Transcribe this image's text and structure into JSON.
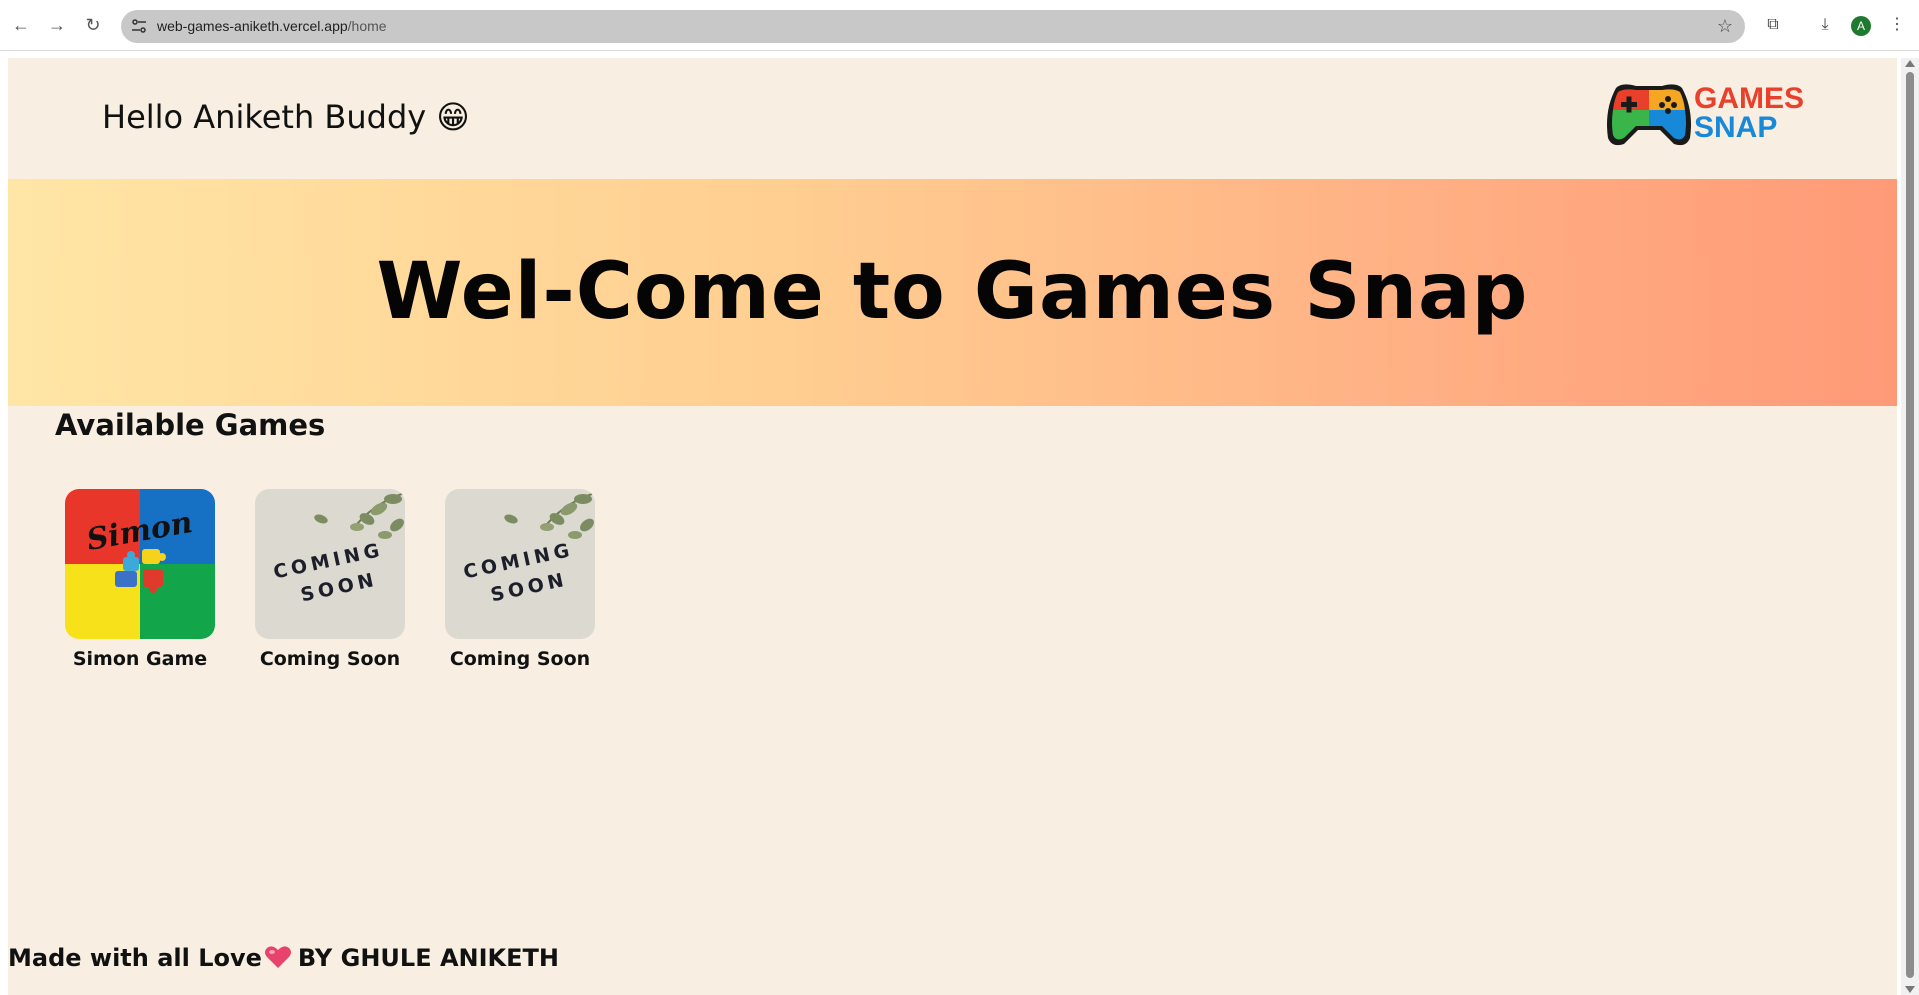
{
  "browser": {
    "url_host": "web-games-aniketh.vercel.app",
    "url_path": "/home",
    "profile_initial": "A"
  },
  "header": {
    "greeting": "Hello Aniketh Buddy 😁",
    "logo_line1": "GAMES",
    "logo_line2": "SNAP"
  },
  "banner": {
    "title": "Wel-Come to Games Snap"
  },
  "games_section": {
    "title": "Available Games",
    "games": [
      {
        "label": "Simon Game",
        "thumbnail_text": "Simon"
      },
      {
        "label": "Coming Soon",
        "thumbnail_line1": "COMING",
        "thumbnail_line2": "SOON"
      },
      {
        "label": "Coming Soon",
        "thumbnail_line1": "COMING",
        "thumbnail_line2": "SOON"
      }
    ]
  },
  "footer": {
    "text_before": "Made with all Love",
    "text_after": "BY GHULE ANIKETH"
  },
  "colors": {
    "page_bg": "#f8efe2",
    "banner_start": "#ffe6a6",
    "banner_end": "#ff9a77",
    "logo_orange": "#e8402a",
    "logo_blue": "#1789d8"
  }
}
